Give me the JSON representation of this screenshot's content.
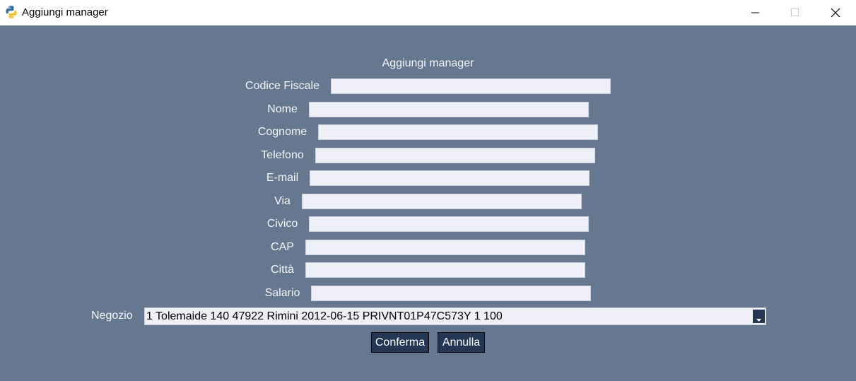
{
  "window": {
    "title": "Aggiungi manager"
  },
  "form": {
    "heading": "Aggiungi manager",
    "fields": [
      {
        "label": "Codice Fiscale",
        "value": ""
      },
      {
        "label": "Nome",
        "value": ""
      },
      {
        "label": "Cognome",
        "value": ""
      },
      {
        "label": "Telefono",
        "value": ""
      },
      {
        "label": "E-mail",
        "value": ""
      },
      {
        "label": "Via",
        "value": ""
      },
      {
        "label": "Civico",
        "value": ""
      },
      {
        "label": "CAP",
        "value": ""
      },
      {
        "label": "Città",
        "value": ""
      },
      {
        "label": "Salario",
        "value": ""
      }
    ],
    "negozio": {
      "label": "Negozio",
      "selected": "1 Tolemaide 140 47922 Rimini 2012-06-15 PRIVNT01P47C573Y 1 100"
    },
    "buttons": {
      "confirm": "Conferma",
      "cancel": "Annulla"
    }
  },
  "colors": {
    "background": "#667790",
    "button": "#233654",
    "field": "#f0f0f8"
  }
}
